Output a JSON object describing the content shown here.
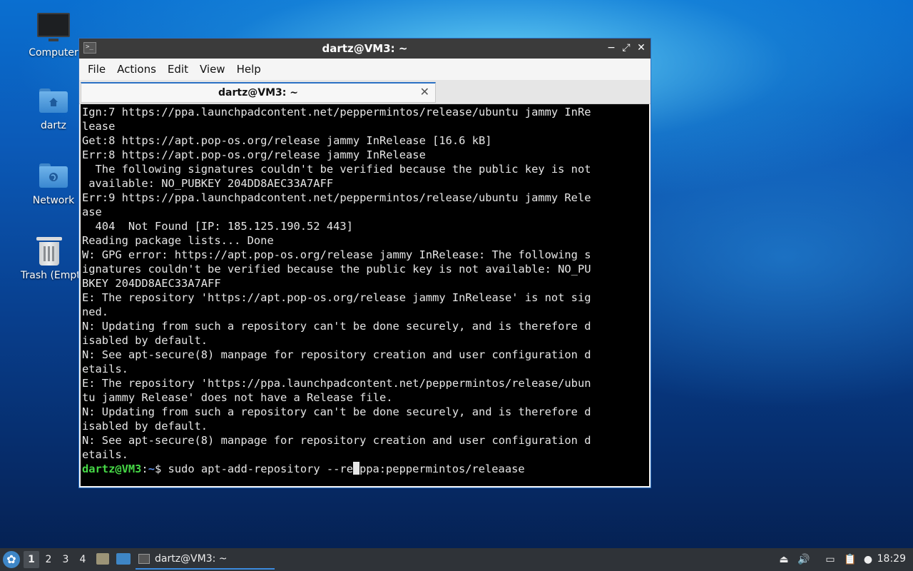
{
  "desktop": {
    "icons": [
      {
        "label": "Computer"
      },
      {
        "label": "dartz"
      },
      {
        "label": "Network"
      },
      {
        "label": "Trash (Empty)"
      }
    ]
  },
  "window": {
    "title": "dartz@VM3: ~",
    "menu": [
      "File",
      "Actions",
      "Edit",
      "View",
      "Help"
    ],
    "tab_label": "dartz@VM3: ~",
    "controls": {
      "minimize": "−",
      "maximize": "⤢",
      "close": "✕"
    }
  },
  "terminal": {
    "lines": [
      "Ign:7 https://ppa.launchpadcontent.net/peppermintos/release/ubuntu jammy InRe",
      "lease",
      "Get:8 https://apt.pop-os.org/release jammy InRelease [16.6 kB]",
      "Err:8 https://apt.pop-os.org/release jammy InRelease",
      "  The following signatures couldn't be verified because the public key is not",
      " available: NO_PUBKEY 204DD8AEC33A7AFF",
      "Err:9 https://ppa.launchpadcontent.net/peppermintos/release/ubuntu jammy Rele",
      "ase",
      "  404  Not Found [IP: 185.125.190.52 443]",
      "Reading package lists... Done",
      "W: GPG error: https://apt.pop-os.org/release jammy InRelease: The following s",
      "ignatures couldn't be verified because the public key is not available: NO_PU",
      "BKEY 204DD8AEC33A7AFF",
      "E: The repository 'https://apt.pop-os.org/release jammy InRelease' is not sig",
      "ned.",
      "N: Updating from such a repository can't be done securely, and is therefore d",
      "isabled by default.",
      "N: See apt-secure(8) manpage for repository creation and user configuration d",
      "etails.",
      "E: The repository 'https://ppa.launchpadcontent.net/peppermintos/release/ubun",
      "tu jammy Release' does not have a Release file.",
      "N: Updating from such a repository can't be done securely, and is therefore d",
      "isabled by default.",
      "N: See apt-secure(8) manpage for repository creation and user configuration d",
      "etails."
    ],
    "prompt_user": "dartz@VM3",
    "prompt_sep": ":",
    "prompt_path": "~",
    "prompt_symbol": "$ ",
    "command_before_cursor": "sudo apt-add-repository --re",
    "command_after_cursor": "ppa:peppermintos/releaase"
  },
  "taskbar": {
    "workspaces": [
      "1",
      "2",
      "3",
      "4"
    ],
    "active_workspace": "1",
    "task_label": "dartz@VM3: ~",
    "clock": "18:29"
  }
}
